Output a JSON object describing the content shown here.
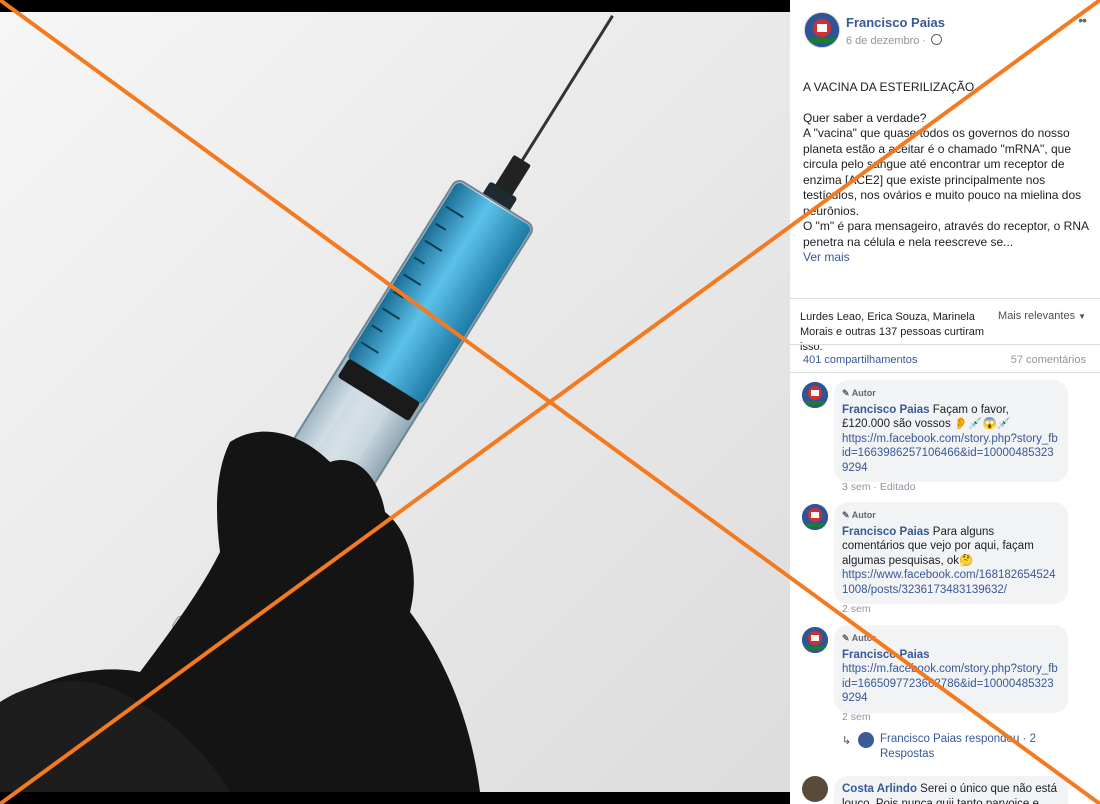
{
  "post": {
    "author": "Francisco Paias",
    "date": "6 de dezembro ·",
    "menu_icon": "more-dots-icon",
    "title": "A VACINA DA ESTERILIZAÇÃO",
    "body_lines": [
      "Quer saber a verdade?",
      "A \"vacina\" que quase todos os governos do nosso planeta estão a aceitar é o chamado \"mRNA\", que circula pelo sangue até encontrar um receptor de enzima [ACE2] que existe principalmente nos testículos, nos ovários e muito pouco na mielina dos neurônios.",
      "O \"m\" é para mensageiro, através do receptor, o RNA penetra na célula e nela reescreve se..."
    ],
    "see_more": "Ver mais"
  },
  "reactions": {
    "likes_text": "Lurdes Leao, Erica Souza, Marinela Morais e outras 137 pessoas curtiram isso.",
    "sort_label": "Mais relevantes",
    "shares": "401 compartilhamentos",
    "comments": "57 comentários"
  },
  "comments": [
    {
      "badge": "Autor",
      "name": "Francisco Paias",
      "text": "Façam o favor, £120.000 são vossos 👂💉😱💉",
      "link": "https://m.facebook.com/story.php?story_fbid=1663986257106466&id=100004853239294",
      "time": "3 sem · Editado"
    },
    {
      "badge": "Autor",
      "name": "Francisco Paias",
      "text": "Para alguns comentários que vejo por aqui, façam algumas pesquisas, ok🤔",
      "link": "https://www.facebook.com/1681826545241008/posts/3236173483139632/",
      "time": "2 sem"
    },
    {
      "badge": "Autor",
      "name": "Francisco Paias",
      "text": "",
      "link": "https://m.facebook.com/story.php?story_fbid=1665097723662786&id=100004853239294",
      "time": "2 sem"
    },
    {
      "badge": "",
      "name": "Costa Arlindo",
      "text": "Serei o único que não está louco. Pois nunca quii tanto parvoice e...",
      "link": "",
      "time": ""
    }
  ],
  "reply": {
    "text": "Francisco Paias respondeu · 2 Respostas"
  },
  "colors": {
    "link": "#385898",
    "cross": "#f47a20",
    "liquid": "#2a8fbf"
  }
}
